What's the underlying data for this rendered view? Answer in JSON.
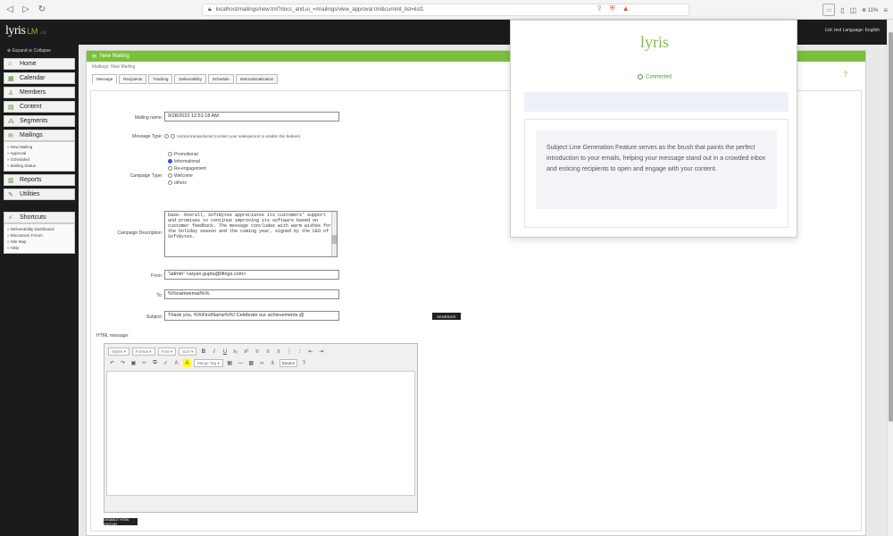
{
  "browser": {
    "back": "◁",
    "forward": "▷",
    "reload": "↻",
    "url": "localhost/mailings/new.tml?docs_and,ui_=/mailings/view_approval.tml&current_list=list1",
    "zoom": "⊕ 11%"
  },
  "header": {
    "logo": "lyris",
    "logo_product": "LM",
    "logo_version": "v14",
    "right_text": "List: test  Language: English"
  },
  "sidebar": {
    "expand_label": "⊕ Expand  ⊖ Collapse",
    "items": [
      {
        "label": "Home",
        "icon": "home-icon"
      },
      {
        "label": "Calendar",
        "icon": "calendar-icon"
      },
      {
        "label": "Members",
        "icon": "members-icon"
      },
      {
        "label": "Content",
        "icon": "content-icon"
      },
      {
        "label": "Segments",
        "icon": "segments-icon"
      },
      {
        "label": "Mailings",
        "icon": "mailings-icon"
      }
    ],
    "mailings_sub": [
      "» New Mailing",
      "» Approval",
      "» Scheduled",
      "» Mailing Status"
    ],
    "items2": [
      {
        "label": "Reports",
        "icon": "reports-icon"
      },
      {
        "label": "Utilities",
        "icon": "utilities-icon"
      }
    ],
    "shortcuts_label": "Shortcuts",
    "shortcuts_sub": [
      "» Deliverability Dashboard",
      "» Discussion Forum",
      "» Site Map",
      "» Help"
    ]
  },
  "main": {
    "title": "New Mailing",
    "breadcrumb": "Mailings: New Mailing",
    "tabs": [
      "Message",
      "Recipients",
      "Tracking",
      "Deliverability",
      "Schedule",
      "Internationalization"
    ]
  },
  "form": {
    "mailing_name_label": "Mailing name:",
    "mailing_name_value": "9/28/2023 12:51:18 AM",
    "message_type_label": "Message Type:",
    "message_type_opts": "normal  transactional  (contact your salesperson to enable this feature)",
    "campaign_type_label": "Campaign Type:",
    "campaign_types": [
      "Promotional",
      "Informational",
      "Re-engagement",
      "Welcome",
      "others"
    ],
    "campaign_desc_label": "Campaign Description:",
    "campaign_desc_text": "base. Overall, SoftBytes appreciates its customers' support and promises to continue improving its software based on customer feedback. The message concludes with warm wishes for the holiday season and the coming year, signed by the CEO of SoftBytes.",
    "from_label": "From:",
    "from_value": "\"admin\" <aryan.gupta@lifings.com>",
    "to_label": "To:",
    "to_value": "%%nameemail%%",
    "subject_label": "Subject:",
    "subject_value": "Thank you, %%FirstName%%! Celebrate our achievements @",
    "generate_btn": "GENERATE",
    "html_message_label": "HTML message:",
    "editor_styles": "Styles",
    "editor_format": "Format",
    "editor_font": "Font",
    "editor_size": "Size",
    "editor_merge": "Merge Tag",
    "editor_source": "Source",
    "disable_btn": "DISABLE HTML EDITOR"
  },
  "popup": {
    "logo": "lyris",
    "status": "Connected",
    "message": "Subject Line Generation Feature serves as the brush that paints the perfect introduction to your emails, helping your message stand out in a crowded inbox and enticing recipients to open and engage with your content."
  }
}
